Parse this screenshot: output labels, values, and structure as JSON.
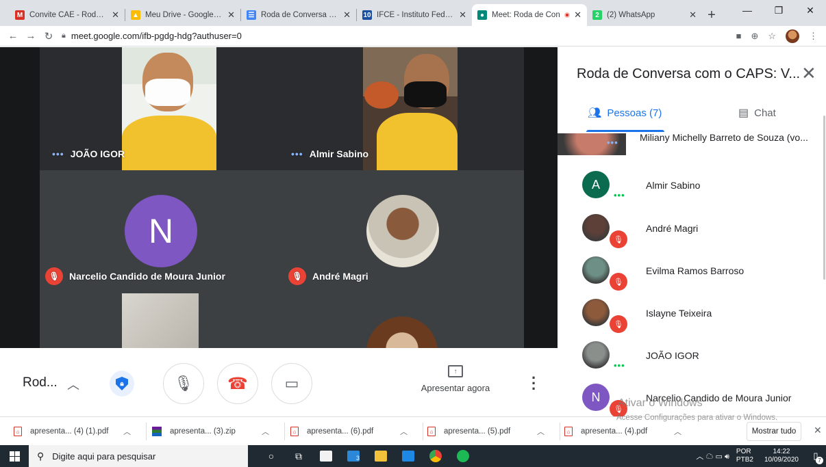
{
  "browser": {
    "tabs": [
      {
        "label": "Convite CAE - Roda de",
        "icon": "gmail-icon",
        "color": "#d93025",
        "glyph": "M",
        "active": false
      },
      {
        "label": "Meu Drive - Google Dri",
        "icon": "drive-icon",
        "color": "#fbbc04",
        "glyph": "▲",
        "active": false
      },
      {
        "label": "Roda de Conversa com",
        "icon": "docs-icon",
        "color": "#4285f4",
        "glyph": "☰",
        "active": false
      },
      {
        "label": "IFCE - Instituto Federal",
        "icon": "ifce-icon",
        "color": "#1a4fa0",
        "glyph": "10",
        "active": false
      },
      {
        "label": "Meet: Roda de Con",
        "icon": "meet-icon",
        "color": "#00897b",
        "glyph": "●",
        "active": true,
        "recording": true
      },
      {
        "label": "(2) WhatsApp",
        "icon": "whatsapp-icon",
        "color": "#25d366",
        "glyph": "2",
        "active": false
      }
    ],
    "url": "meet.google.com/ifb-pgdg-hdg?authuser=0"
  },
  "meet": {
    "tiles": [
      {
        "name": "JOÃO IGOR",
        "status": "dots"
      },
      {
        "name": "Almir Sabino",
        "status": "dots"
      },
      {
        "name": "Narcelio Candido de Moura Junior",
        "status": "muted",
        "avatar_letter": "N",
        "avatar_color": "#7e57c2"
      },
      {
        "name": "André Magri",
        "status": "muted"
      }
    ],
    "controls": {
      "meeting_short": "Rod...",
      "present_label": "Apresentar agora"
    }
  },
  "panel": {
    "title": "Roda de Conversa com o CAPS: V...",
    "people_tab": "Pessoas (7)",
    "chat_tab": "Chat",
    "participants": [
      {
        "name": "Miliany Michelly Barreto de Souza (vo...",
        "status": "dots",
        "avatar": "photo",
        "color": "#c77b6a"
      },
      {
        "name": "Almir Sabino",
        "status": "dots",
        "avatar": "letter",
        "letter": "A",
        "color": "#0b6b4f"
      },
      {
        "name": "André Magri",
        "status": "muted",
        "avatar": "photo",
        "color": "#5d4037"
      },
      {
        "name": "Evilma Ramos Barroso",
        "status": "muted",
        "avatar": "photo",
        "color": "#6d8f85"
      },
      {
        "name": "Islayne Teixeira",
        "status": "muted",
        "avatar": "photo",
        "color": "#8d5a3c"
      },
      {
        "name": "JOÃO IGOR",
        "status": "dots",
        "avatar": "photo",
        "color": "#8a8f8c"
      },
      {
        "name": "Narcelio Candido de Moura Junior",
        "status": "muted",
        "avatar": "letter",
        "letter": "N",
        "color": "#7e57c2"
      }
    ],
    "watermark_line1": "Ativar o Windows",
    "watermark_line2": "Acesse Configurações para ativar o Windows."
  },
  "downloads": {
    "items": [
      {
        "label": "apresenta... (4) (1).pdf",
        "type": "pdf"
      },
      {
        "label": "apresenta... (3).zip",
        "type": "zip"
      },
      {
        "label": "apresenta... (6).pdf",
        "type": "pdf"
      },
      {
        "label": "apresenta... (5).pdf",
        "type": "pdf"
      },
      {
        "label": "apresenta... (4).pdf",
        "type": "pdf"
      }
    ],
    "show_all": "Mostrar tudo"
  },
  "taskbar": {
    "search_placeholder": "Digite aqui para pesquisar",
    "language": "POR",
    "layout": "PTB2",
    "time": "14:22",
    "date": "10/09/2020",
    "mail_badge": "3",
    "notif_count": "7"
  }
}
